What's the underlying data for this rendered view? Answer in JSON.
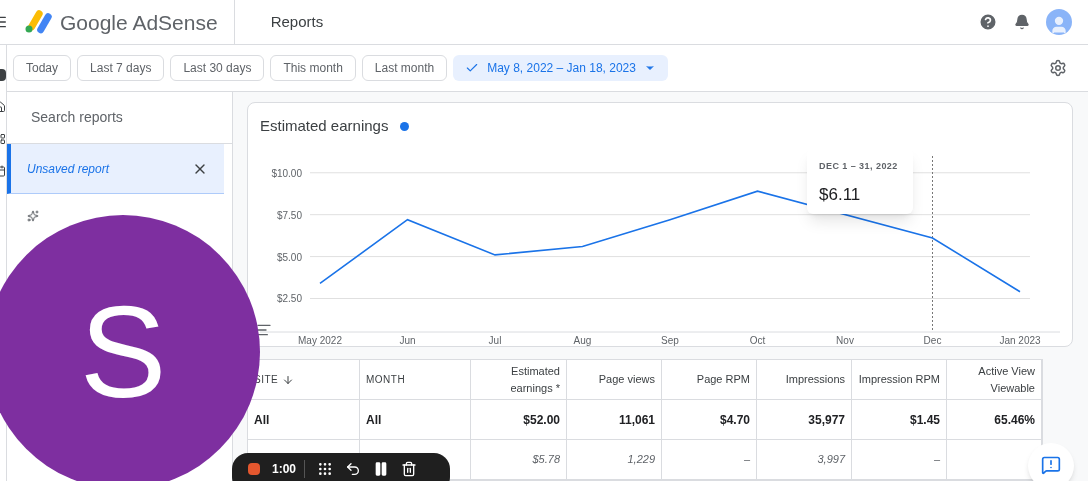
{
  "header": {
    "product": "Google AdSense",
    "page_title": "Reports"
  },
  "date_filters": [
    {
      "label": "Today",
      "selected": false
    },
    {
      "label": "Last 7 days",
      "selected": false
    },
    {
      "label": "Last 30 days",
      "selected": false
    },
    {
      "label": "This month",
      "selected": false
    },
    {
      "label": "Last month",
      "selected": false
    },
    {
      "label": "May 8, 2022 – Jan 18, 2023",
      "selected": true
    }
  ],
  "report_panel": {
    "search": {
      "placeholder": "Search reports"
    },
    "items": [
      {
        "label": "Unsaved report",
        "selected": true
      }
    ]
  },
  "chart_card": {
    "tooltip": {
      "period": "DEC 1 – 31, 2022",
      "value": "$6.11"
    },
    "chart_data": {
      "type": "line",
      "categories": [
        "May 2022",
        "Jun",
        "Jul",
        "Aug",
        "Sep",
        "Oct",
        "Nov",
        "Dec",
        "Jan 2023"
      ],
      "series": [
        {
          "name": "Estimated earnings",
          "color": "#1a73e8",
          "values": [
            3.4,
            7.2,
            5.1,
            5.6,
            7.2,
            8.9,
            null,
            6.11,
            2.9
          ]
        }
      ],
      "grid": true,
      "yticks": [
        {
          "value": 2.5,
          "label": "$2.50"
        },
        {
          "value": 5,
          "label": "$5.00"
        },
        {
          "value": 7.5,
          "label": "$7.50"
        },
        {
          "value": 10,
          "label": "$10.00"
        }
      ],
      "ylim": [
        0.5,
        11
      ],
      "ref_lines": [
        {
          "axis": "x",
          "value": "Dec"
        }
      ]
    }
  },
  "table": {
    "columns": [
      {
        "label": "SITE",
        "sorted": true
      },
      {
        "label": "MONTH",
        "sorted": false
      },
      {
        "label": "Estimated earnings *",
        "sorted": false
      },
      {
        "label": "Page views",
        "sorted": false
      },
      {
        "label": "Page RPM",
        "sorted": false
      },
      {
        "label": "Impressions",
        "sorted": false
      },
      {
        "label": "Impression RPM",
        "sorted": false
      },
      {
        "label": "Active View Viewable",
        "sorted": false
      }
    ],
    "rows": [
      {
        "kind": "total",
        "cells": [
          "All",
          "All",
          "$52.00",
          "11,061",
          "$4.70",
          "35,977",
          "$1.45",
          "65.46%"
        ]
      },
      {
        "kind": "month",
        "cells": [
          "",
          "",
          "$5.78",
          "1,229",
          "–",
          "3,997",
          "–",
          ""
        ]
      }
    ]
  },
  "webcam": {
    "initial": "S"
  },
  "recorder": {
    "time": "1:00"
  }
}
